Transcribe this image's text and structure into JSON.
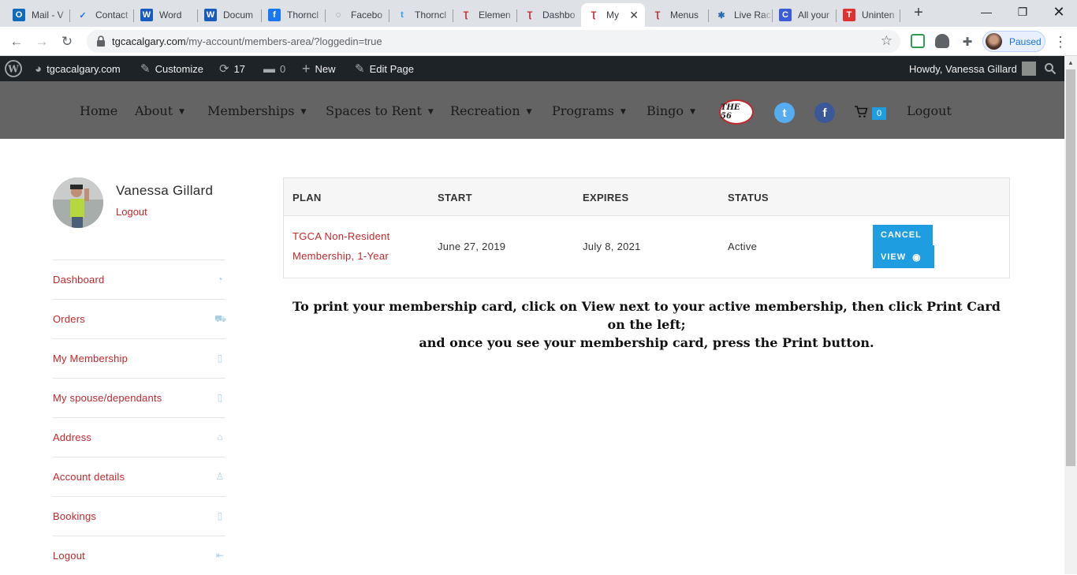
{
  "browser": {
    "tabs": [
      {
        "title": "Mail - V",
        "fav": "O",
        "favbg": "#0f6cbd",
        "favfg": "#fff"
      },
      {
        "title": "Contact",
        "fav": "✓",
        "favbg": "transparent",
        "favfg": "#1a73e8"
      },
      {
        "title": "Word",
        "fav": "W",
        "favbg": "#185abd",
        "favfg": "#fff"
      },
      {
        "title": "Docum",
        "fav": "W",
        "favbg": "#185abd",
        "favfg": "#fff"
      },
      {
        "title": "Thorncl",
        "fav": "f",
        "favbg": "#1877f2",
        "favfg": "#fff"
      },
      {
        "title": "Facebo",
        "fav": "◌",
        "favbg": "transparent",
        "favfg": "#5f6368"
      },
      {
        "title": "Thorncl",
        "fav": "t",
        "favbg": "transparent",
        "favfg": "#1da1f2"
      },
      {
        "title": "Elemen",
        "fav": "Ʈ",
        "favbg": "transparent",
        "favfg": "#c0282d"
      },
      {
        "title": "Dashbo",
        "fav": "Ʈ",
        "favbg": "transparent",
        "favfg": "#c0282d"
      },
      {
        "title": "My",
        "fav": "Ʈ",
        "favbg": "transparent",
        "favfg": "#c0282d"
      },
      {
        "title": "Menus",
        "fav": "Ʈ",
        "favbg": "transparent",
        "favfg": "#c0282d"
      },
      {
        "title": "Live Rac",
        "fav": "✱",
        "favbg": "transparent",
        "favfg": "#2b6cb0"
      },
      {
        "title": "All your",
        "fav": "C",
        "favbg": "#3b5bdb",
        "favfg": "#fff"
      },
      {
        "title": "Uninten",
        "fav": "T",
        "favbg": "#e03131",
        "favfg": "#fff"
      }
    ],
    "active_tab": 9,
    "url_host": "tgcacalgary.com",
    "url_rest": "/my-account/members-area/?loggedin=true",
    "profile_status": "Paused"
  },
  "adminbar": {
    "site": "tgcacalgary.com",
    "customize": "Customize",
    "updates": "17",
    "comments": "0",
    "new": "New",
    "edit": "Edit Page",
    "howdy": "Howdy, Vanessa Gillard"
  },
  "nav": {
    "home": "Home",
    "about": "About",
    "memberships": "Memberships",
    "spaces": "Spaces to Rent",
    "recreation": "Recreation",
    "programs": "Programs",
    "bingo": "Bingo",
    "logo": "THE 56",
    "cart_count": "0",
    "logout": "Logout"
  },
  "user": {
    "name": "Vanessa Gillard",
    "logout": "Logout"
  },
  "sidebar": {
    "items": [
      {
        "label": "Dashboard",
        "icon": "dashboard-icon"
      },
      {
        "label": "Orders",
        "icon": "cart-icon"
      },
      {
        "label": "My Membership",
        "icon": "document-icon"
      },
      {
        "label": "My spouse/dependants",
        "icon": "document-icon"
      },
      {
        "label": "Address",
        "icon": "home-icon"
      },
      {
        "label": "Account details",
        "icon": "user-icon"
      },
      {
        "label": "Bookings",
        "icon": "document-icon"
      },
      {
        "label": "Logout",
        "icon": "sign-out-icon"
      }
    ]
  },
  "table": {
    "headers": {
      "plan": "PLAN",
      "start": "START",
      "expires": "EXPIRES",
      "status": "STATUS"
    },
    "row": {
      "plan_line1": "TGCA Non-Resident",
      "plan_line2": "Membership, 1-Year",
      "start": "June 27, 2019",
      "expires": "July 8, 2021",
      "status": "Active",
      "cancel": "CANCEL",
      "view": "VIEW"
    }
  },
  "note": {
    "line1": "To print your membership card, click on View next to your active membership, then click Print Card on the left;",
    "line2": "and once you see your membership card, press the Print button."
  },
  "colors": {
    "accent": "#c0282d",
    "button": "#1e9de0",
    "header": "#646464",
    "adminbar": "#1d2327"
  }
}
